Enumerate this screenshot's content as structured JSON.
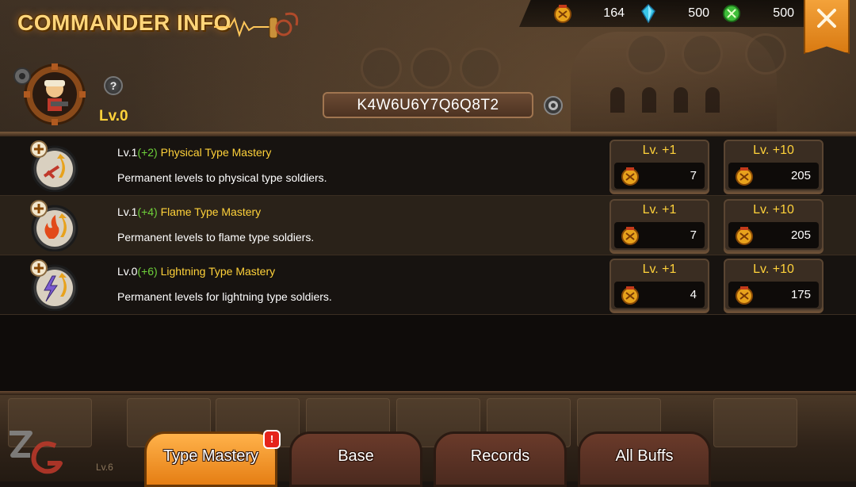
{
  "header": {
    "title": "COMMANDER INFO",
    "close_icon": "close-icon"
  },
  "currencies": [
    {
      "icon": "medal-icon",
      "value": "164",
      "color": "#e8a21c"
    },
    {
      "icon": "crystal-icon",
      "value": "500",
      "color": "#39c6e8"
    },
    {
      "icon": "green-gem-icon",
      "value": "500",
      "color": "#3fbf3a"
    }
  ],
  "commander": {
    "level": "Lv.0",
    "code": "K4W6U6Y7Q6Q8T2",
    "help_label": "?"
  },
  "masteries": [
    {
      "level": "Lv.1",
      "bonus": "(+2)",
      "name": "Physical Type Mastery",
      "description": "Permanent levels to physical type soldiers.",
      "icon": "physical-mastery-icon",
      "upgrade_1": {
        "label": "Lv. +1",
        "cost": "7"
      },
      "upgrade_10": {
        "label": "Lv. +10",
        "cost": "205"
      }
    },
    {
      "level": "Lv.1",
      "bonus": "(+4)",
      "name": "Flame Type Mastery",
      "description": "Permanent levels to flame type soldiers.",
      "icon": "flame-mastery-icon",
      "upgrade_1": {
        "label": "Lv. +1",
        "cost": "7"
      },
      "upgrade_10": {
        "label": "Lv. +10",
        "cost": "205"
      }
    },
    {
      "level": "Lv.0",
      "bonus": "(+6)",
      "name": "Lightning Type Mastery",
      "description": "Permanent levels for lightning type soldiers.",
      "icon": "lightning-mastery-icon",
      "upgrade_1": {
        "label": "Lv. +1",
        "cost": "4"
      },
      "upgrade_10": {
        "label": "Lv. +10",
        "cost": "175"
      }
    }
  ],
  "tabs": [
    {
      "label": "Type Mastery",
      "active": true,
      "alert": "!"
    },
    {
      "label": "Base",
      "active": false
    },
    {
      "label": "Records",
      "active": false
    },
    {
      "label": "All Buffs",
      "active": false
    }
  ],
  "background": {
    "bottom_level": "Lv.6"
  }
}
